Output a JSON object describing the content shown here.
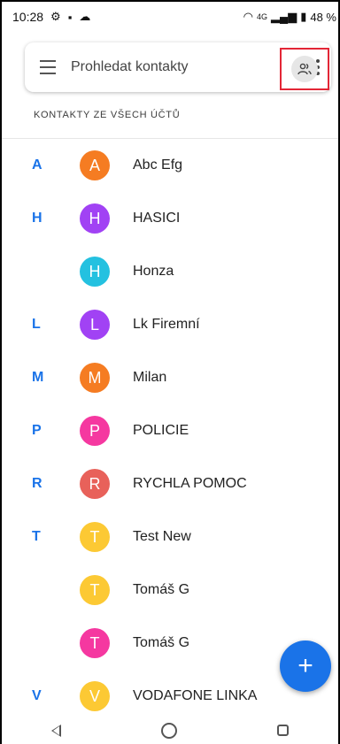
{
  "status_bar": {
    "time": "10:28",
    "network": "4G",
    "battery": "48 %"
  },
  "search": {
    "placeholder": "Prohledat kontakty"
  },
  "section_header": "KONTAKTY ZE VŠECH ÚČTŮ",
  "contacts": [
    {
      "index_letter": "A",
      "initial": "A",
      "name": "Abc Efg",
      "color": "#f57c22"
    },
    {
      "index_letter": "H",
      "initial": "H",
      "name": "HASICI",
      "color": "#a142f4"
    },
    {
      "index_letter": "",
      "initial": "H",
      "name": "Honza",
      "color": "#24c1e0"
    },
    {
      "index_letter": "L",
      "initial": "L",
      "name": "Lk Firemní",
      "color": "#a142f4"
    },
    {
      "index_letter": "M",
      "initial": "M",
      "name": "Milan",
      "color": "#f57c22"
    },
    {
      "index_letter": "P",
      "initial": "P",
      "name": "POLICIE",
      "color": "#f538a0"
    },
    {
      "index_letter": "R",
      "initial": "R",
      "name": "RYCHLA POMOC",
      "color": "#e8615a"
    },
    {
      "index_letter": "T",
      "initial": "T",
      "name": "Test New",
      "color": "#fcc934"
    },
    {
      "index_letter": "",
      "initial": "T",
      "name": "Tomáš G",
      "color": "#fcc934"
    },
    {
      "index_letter": "",
      "initial": "T",
      "name": "Tomáš G",
      "color": "#f538a0"
    },
    {
      "index_letter": "V",
      "initial": "V",
      "name": "VODAFONE LINKA",
      "color": "#fcc934"
    }
  ],
  "fab": {
    "label": "+"
  },
  "colors": {
    "accent": "#1a73e8",
    "highlight_box": "#e32636"
  }
}
